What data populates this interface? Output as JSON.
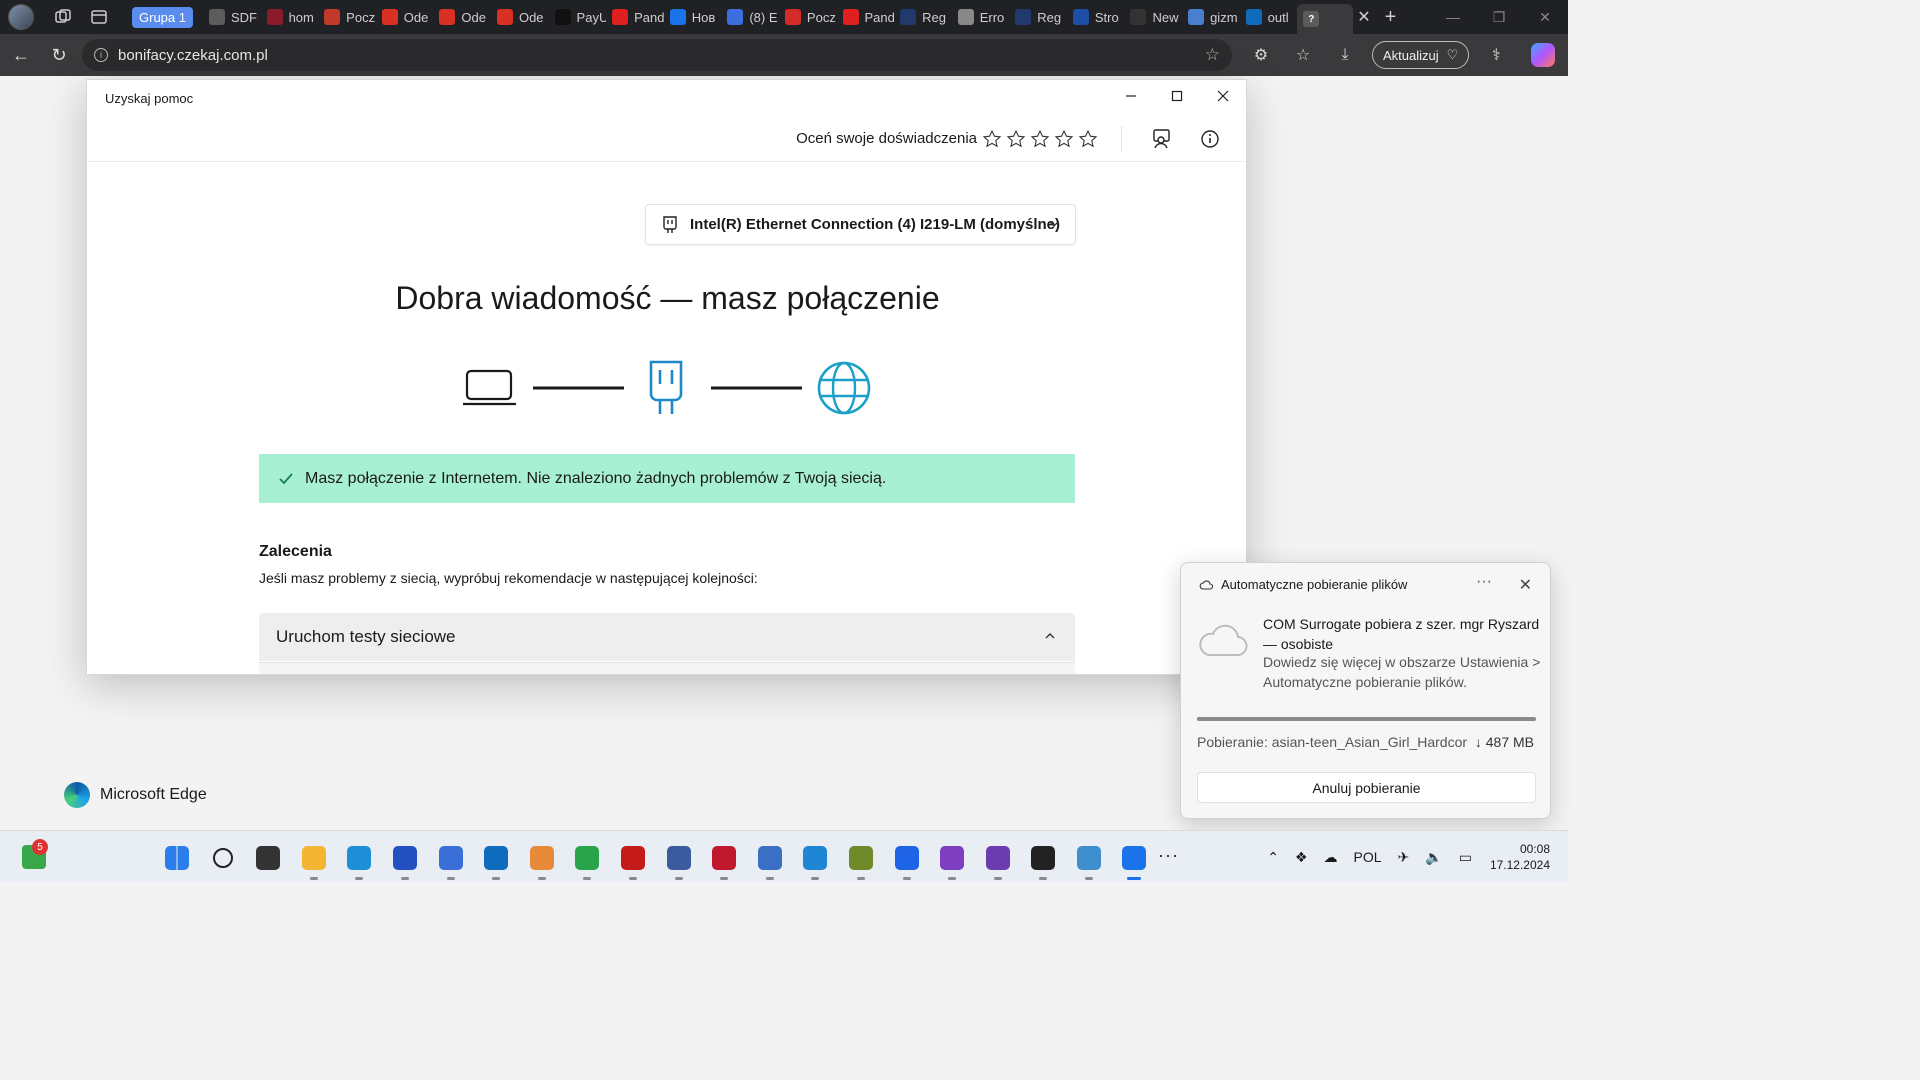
{
  "browser": {
    "tab_group_label": "Grupa 1",
    "tabs": [
      {
        "title": "SDF",
        "color": "#5c5c5c"
      },
      {
        "title": "hom",
        "color": "#8b1a2b"
      },
      {
        "title": "Pocz",
        "color": "#c0392b"
      },
      {
        "title": "Ode",
        "color": "#d93025"
      },
      {
        "title": "Ode",
        "color": "#d93025"
      },
      {
        "title": "Ode",
        "color": "#d93025"
      },
      {
        "title": "PayU",
        "color": "#111111"
      },
      {
        "title": "Pand",
        "color": "#e02020"
      },
      {
        "title": "Нов",
        "color": "#1a73e8"
      },
      {
        "title": "(8) E",
        "color": "#3b6fe0"
      },
      {
        "title": "Pocz",
        "color": "#d42b2b"
      },
      {
        "title": "Pand",
        "color": "#e02020"
      },
      {
        "title": "Reg",
        "color": "#203a6e"
      },
      {
        "title": "Erro",
        "color": "#888888"
      },
      {
        "title": "Reg",
        "color": "#203a6e"
      },
      {
        "title": "Stro",
        "color": "#1e4fa8"
      },
      {
        "title": "New",
        "color": "#333333"
      },
      {
        "title": "gizm",
        "color": "#4a7fd0"
      },
      {
        "title": "outl",
        "color": "#0f6cbd"
      }
    ],
    "active_tab_close": "✕",
    "new_tab": "+",
    "address_url": "bonifacy.czekaj.com.pl",
    "update_button": "Aktualizuj"
  },
  "edge_brand": "Microsoft Edge",
  "get_help": {
    "window_title": "Uzyskaj pomoc",
    "rate_label": "Oceń swoje doświadczenia",
    "star_count": 5,
    "adapter_label": "Intel(R) Ethernet Connection (4) I219-LM (domyślne)",
    "heading": "Dobra wiadomość — masz połączenie",
    "success_message": "Masz połączenie z Internetem. Nie znaleziono żadnych problemów z Twoją siecią.",
    "recommendations_title": "Zalecenia",
    "recommendations_subtitle": "Jeśli masz problemy z siecią, wypróbuj rekomendacje w następującej kolejności:",
    "accordion_title": "Uruchom testy sieciowe",
    "colors": {
      "success_bg": "#a8f0d3",
      "accent": "#1e88c9",
      "globe": "#1aa0c8"
    }
  },
  "toast": {
    "title": "Automatyczne pobieranie plików",
    "more": "···",
    "close": "✕",
    "main_text": "COM Surrogate pobiera z szer. mgr Ryszard — osobiste",
    "detail_text": "Dowiedz się więcej w obszarze Ustawienia > Automatyczne pobieranie plików.",
    "download_label": "Pobieranie: asian-teen_Asian_Girl_Hardcor",
    "download_size": "↓ 487 MB",
    "progress": 1.0,
    "cancel_button": "Anuluj pobieranie"
  },
  "taskbar": {
    "widget_badge": "5",
    "apps": [
      {
        "name": "start",
        "color": "#2b7de9"
      },
      {
        "name": "search",
        "color": "#222222"
      },
      {
        "name": "task-view",
        "color": "#333333"
      },
      {
        "name": "file-explorer",
        "color": "#f2b632"
      },
      {
        "name": "edge",
        "color": "#1e8fd6"
      },
      {
        "name": "save",
        "color": "#2450c2"
      },
      {
        "name": "store",
        "color": "#3a6fd8"
      },
      {
        "name": "outlook",
        "color": "#0f6cbd"
      },
      {
        "name": "paint",
        "color": "#e88a3a"
      },
      {
        "name": "globe",
        "color": "#2aa44a"
      },
      {
        "name": "media",
        "color": "#c41a1a"
      },
      {
        "name": "virtualbox",
        "color": "#3b5b9e"
      },
      {
        "name": "photo-app",
        "color": "#c0182d"
      },
      {
        "name": "network-tool",
        "color": "#3a6fc4"
      },
      {
        "name": "vscode",
        "color": "#1f86d4"
      },
      {
        "name": "tool",
        "color": "#6e8a2a"
      },
      {
        "name": "dropbox",
        "color": "#1f63e6"
      },
      {
        "name": "tor",
        "color": "#7d3fc0"
      },
      {
        "name": "github",
        "color": "#6a3cae"
      },
      {
        "name": "terminal",
        "color": "#222222"
      },
      {
        "name": "system-info",
        "color": "#3d8fd0"
      },
      {
        "name": "get-help",
        "color": "#1a73e8"
      }
    ],
    "more": "···",
    "language": "POL",
    "time": "00:08",
    "date": "17.12.2024"
  }
}
